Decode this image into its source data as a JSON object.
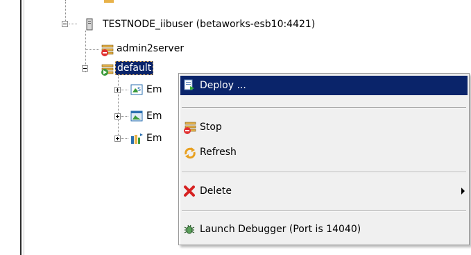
{
  "tree": {
    "node": {
      "label": "TESTNODE_iibuser (betaworks-esb10:4421)",
      "icon": "server-icon"
    },
    "servers": [
      {
        "label": "admin2server",
        "icon": "integration-server-icon"
      },
      {
        "label": "default",
        "icon": "integration-server-icon",
        "selected": true
      }
    ],
    "children": [
      {
        "label": "Em",
        "icon": "soap-app-icon"
      },
      {
        "label": "Em",
        "icon": "application-icon"
      },
      {
        "label": "Em",
        "icon": "library-icon"
      }
    ]
  },
  "context_menu": {
    "items": [
      {
        "label": "Deploy ...",
        "icon": "deploy-icon",
        "highlighted": true
      },
      {
        "label": "Stop",
        "icon": "stop-icon"
      },
      {
        "label": "Refresh",
        "icon": "refresh-icon"
      },
      {
        "label": "Delete",
        "icon": "delete-icon",
        "has_submenu": true
      },
      {
        "label": "Launch Debugger (Port is 14040)",
        "icon": "debugger-icon"
      }
    ]
  },
  "colors": {
    "highlight": "#0a246a",
    "menu_background": "#f0f0f0"
  }
}
